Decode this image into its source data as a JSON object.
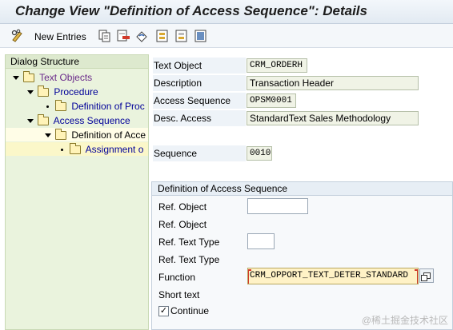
{
  "window": {
    "title": "Change View \"Definition of Access Sequence\": Details"
  },
  "toolbar": {
    "new_entries_label": "New Entries",
    "icons": [
      "pencil-glasses-icon",
      "copy-icon",
      "delete-icon",
      "undo-icon",
      "select-all-icon",
      "deselect-icon",
      "select-block-icon"
    ]
  },
  "dialog_structure": {
    "title": "Dialog Structure",
    "nodes": [
      {
        "label": "Text Objects",
        "level": 0,
        "expanded": true
      },
      {
        "label": "Procedure",
        "level": 1,
        "expanded": true
      },
      {
        "label": "Definition of Proc",
        "level": 2,
        "leaf": true
      },
      {
        "label": "Access Sequence",
        "level": 1,
        "expanded": true
      },
      {
        "label": "Definition of Acce",
        "level": 2,
        "expanded": true,
        "selected": true
      },
      {
        "label": "Assignment o",
        "level": 3,
        "leaf": true
      }
    ]
  },
  "fields": {
    "text_object": {
      "label": "Text Object",
      "value": "CRM_ORDERH"
    },
    "description": {
      "label": "Description",
      "value": "Transaction Header"
    },
    "access_sequence": {
      "label": "Access Sequence",
      "value": "OPSM0001"
    },
    "desc_access": {
      "label": "Desc. Access",
      "value": "StandardText Sales Methodology"
    },
    "sequence": {
      "label": "Sequence",
      "value": "0010"
    }
  },
  "group": {
    "title": "Definition of Access Sequence",
    "ref_object_1": {
      "label": "Ref. Object",
      "value": ""
    },
    "ref_object_2": {
      "label": "Ref. Object"
    },
    "ref_text_type_1": {
      "label": "Ref. Text Type",
      "value": ""
    },
    "ref_text_type_2": {
      "label": "Ref. Text Type"
    },
    "function": {
      "label": "Function",
      "value": "CRM_OPPORT_TEXT_DETER_STANDARD"
    },
    "short_text": {
      "label": "Short text"
    },
    "continue": {
      "label": "Continue",
      "checked": true,
      "check_mark": "✓"
    }
  },
  "watermark": "@稀土掘金技术社区",
  "colors": {
    "tree_background": "#eaf3dd",
    "tree_link": "#000099",
    "function_highlight": "#fff2c6",
    "required_marker": "#d23a2a"
  }
}
